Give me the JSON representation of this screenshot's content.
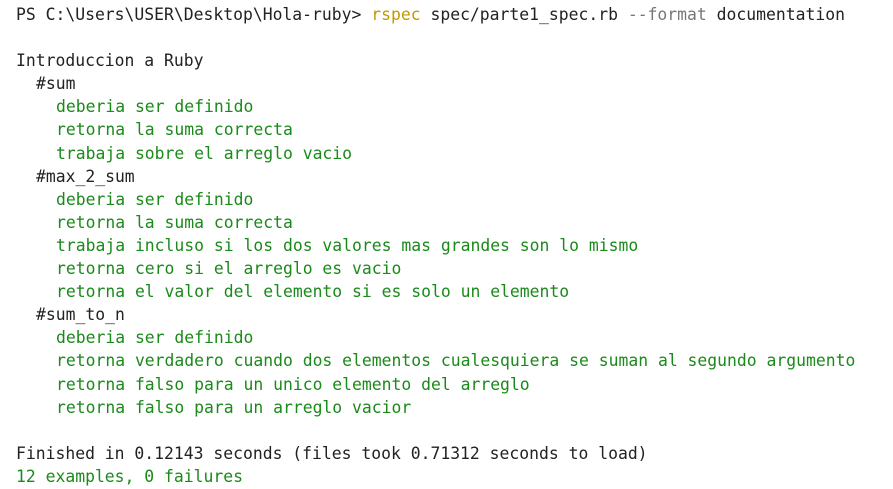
{
  "prompt": {
    "path": "PS C:\\Users\\USER\\Desktop\\Hola-ruby> ",
    "command": "rspec",
    "args": " spec/parte1_spec.rb ",
    "flag": "--format",
    "flag_value": " documentation"
  },
  "suite": {
    "title": "Introduccion a Ruby",
    "groups": [
      {
        "name": "#sum",
        "examples": [
          "deberia ser definido",
          "retorna la suma correcta",
          "trabaja sobre el arreglo vacio"
        ]
      },
      {
        "name": "#max_2_sum",
        "examples": [
          "deberia ser definido",
          "retorna la suma correcta",
          "trabaja incluso si los dos valores mas grandes son lo mismo",
          "retorna cero si el arreglo es vacio",
          "retorna el valor del elemento si es solo un elemento"
        ]
      },
      {
        "name": "#sum_to_n",
        "examples": [
          "deberia ser definido",
          "retorna verdadero cuando dos elementos cualesquiera se suman al segundo argumento",
          "retorna falso para un unico elemento del arreglo",
          "retorna falso para un arreglo vacior"
        ]
      }
    ]
  },
  "summary": {
    "finished": "Finished in 0.12143 seconds (files took 0.71312 seconds to load)",
    "result": "12 examples, 0 failures"
  },
  "colors": {
    "pass": "#1a8a1a",
    "command": "#c29a00",
    "flag": "#777777",
    "text": "#222222",
    "background": "#ffffff"
  }
}
